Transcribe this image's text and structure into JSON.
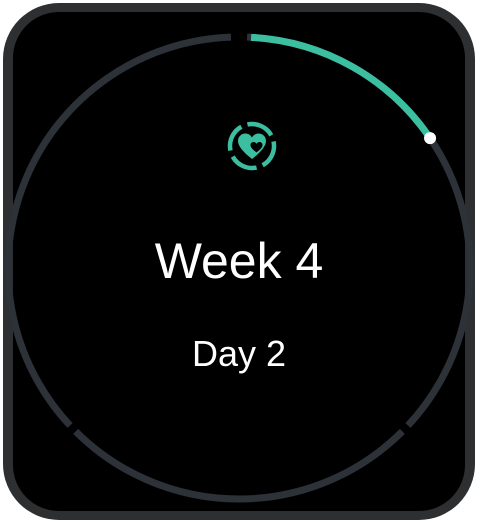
{
  "screen": {
    "week_label": "Week 4",
    "day_label": "Day 2",
    "plan_icon": "heart-target-icon",
    "progress_fraction": 0.155
  },
  "colors": {
    "accent": "#3bbfa0",
    "ring_track": "#2d3138",
    "bezel": "#2e2f31",
    "background": "#000000",
    "text": "#ffffff",
    "indicator": "#ffffff"
  }
}
